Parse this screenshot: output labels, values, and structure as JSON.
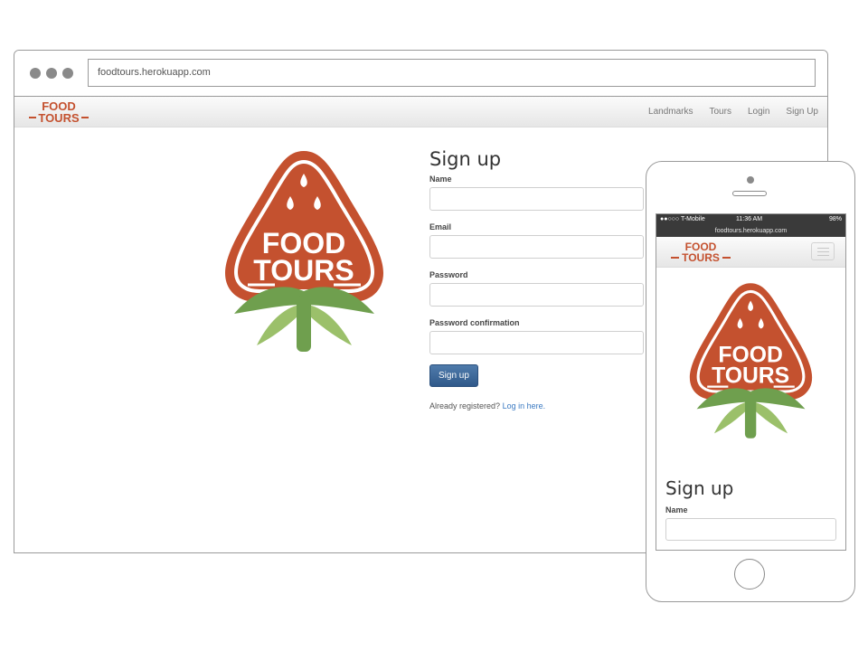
{
  "browser": {
    "url": "foodtours.herokuapp.com"
  },
  "brand": {
    "line1": "FOOD",
    "line2": "TOURS",
    "color": "#c4512f"
  },
  "nav": {
    "items": [
      "Landmarks",
      "Tours",
      "Login",
      "Sign Up"
    ]
  },
  "logo": {
    "line1": "FOOD",
    "line2": "TOURS"
  },
  "form": {
    "title": "Sign up",
    "fields": [
      {
        "label": "Name",
        "value": ""
      },
      {
        "label": "Email",
        "value": ""
      },
      {
        "label": "Password",
        "value": ""
      },
      {
        "label": "Password confirmation",
        "value": ""
      }
    ],
    "submit_label": "Sign up",
    "already_text": "Already registered?",
    "login_link": "Log in here."
  },
  "mobile": {
    "status": {
      "carrier": "●●○○○ T-Mobile",
      "time": "11:36 AM",
      "battery": "98%"
    },
    "url": "foodtours.herokuapp.com",
    "title": "Sign up",
    "name_label": "Name"
  },
  "colors": {
    "accent": "#c4512f",
    "leaf_dark": "#6f9f4e",
    "leaf_light": "#9bc06a",
    "button": "#3a6596",
    "link": "#3b7ac2"
  }
}
